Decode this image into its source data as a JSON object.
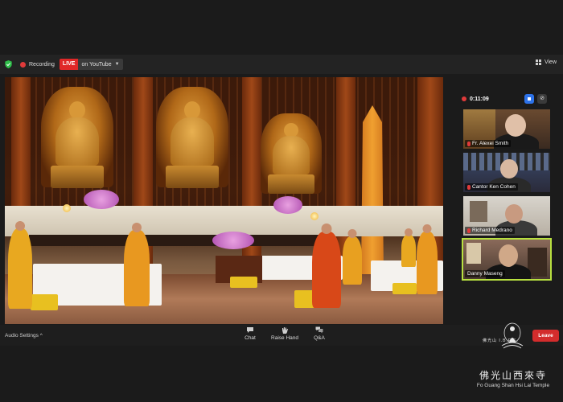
{
  "top_bar": {
    "recording_label": "Recording",
    "live_badge": "LIVE",
    "live_destination": "on YouTube",
    "view_label": "View"
  },
  "timer": {
    "elapsed": "0:11:09"
  },
  "participants": [
    {
      "name": "Fr. Alexei Smith",
      "muted": true,
      "active": false
    },
    {
      "name": "Cantor Ken Cohen",
      "muted": true,
      "active": false
    },
    {
      "name": "Richard Medrano",
      "muted": true,
      "active": false
    },
    {
      "name": "Danny Maseng",
      "muted": false,
      "active": true
    }
  ],
  "bottom_bar": {
    "audio_settings": "Audio Settings",
    "chat": "Chat",
    "raise_hand": "Raise Hand",
    "qa": "Q&A",
    "leave": "Leave"
  },
  "watermark": {
    "logo_small_text": "佛光山 I.B.P.S.",
    "chinese": "佛光山西來寺",
    "english": "Fo Guang Shan Hsi Lai Temple"
  },
  "colors": {
    "live_red": "#e02828",
    "leave_red": "#d32c2c",
    "active_speaker": "#b8e040",
    "stop_blue": "#2d72e8"
  }
}
